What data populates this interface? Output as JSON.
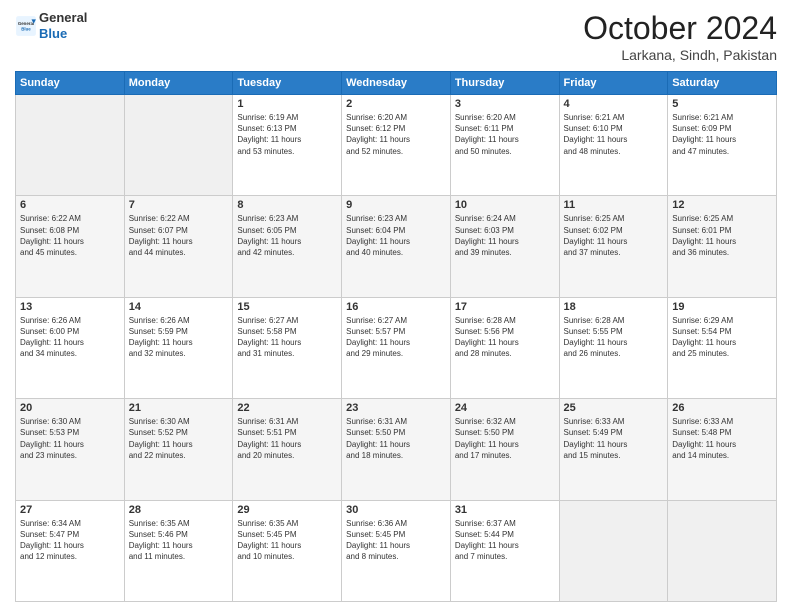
{
  "header": {
    "logo_general": "General",
    "logo_blue": "Blue",
    "title": "October 2024",
    "location": "Larkana, Sindh, Pakistan"
  },
  "days_of_week": [
    "Sunday",
    "Monday",
    "Tuesday",
    "Wednesday",
    "Thursday",
    "Friday",
    "Saturday"
  ],
  "weeks": [
    [
      {
        "day": "",
        "info": ""
      },
      {
        "day": "",
        "info": ""
      },
      {
        "day": "1",
        "sunrise": "6:19 AM",
        "sunset": "6:13 PM",
        "daylight": "11 hours and 53 minutes."
      },
      {
        "day": "2",
        "sunrise": "6:20 AM",
        "sunset": "6:12 PM",
        "daylight": "11 hours and 52 minutes."
      },
      {
        "day": "3",
        "sunrise": "6:20 AM",
        "sunset": "6:11 PM",
        "daylight": "11 hours and 50 minutes."
      },
      {
        "day": "4",
        "sunrise": "6:21 AM",
        "sunset": "6:10 PM",
        "daylight": "11 hours and 48 minutes."
      },
      {
        "day": "5",
        "sunrise": "6:21 AM",
        "sunset": "6:09 PM",
        "daylight": "11 hours and 47 minutes."
      }
    ],
    [
      {
        "day": "6",
        "sunrise": "6:22 AM",
        "sunset": "6:08 PM",
        "daylight": "11 hours and 45 minutes."
      },
      {
        "day": "7",
        "sunrise": "6:22 AM",
        "sunset": "6:07 PM",
        "daylight": "11 hours and 44 minutes."
      },
      {
        "day": "8",
        "sunrise": "6:23 AM",
        "sunset": "6:05 PM",
        "daylight": "11 hours and 42 minutes."
      },
      {
        "day": "9",
        "sunrise": "6:23 AM",
        "sunset": "6:04 PM",
        "daylight": "11 hours and 40 minutes."
      },
      {
        "day": "10",
        "sunrise": "6:24 AM",
        "sunset": "6:03 PM",
        "daylight": "11 hours and 39 minutes."
      },
      {
        "day": "11",
        "sunrise": "6:25 AM",
        "sunset": "6:02 PM",
        "daylight": "11 hours and 37 minutes."
      },
      {
        "day": "12",
        "sunrise": "6:25 AM",
        "sunset": "6:01 PM",
        "daylight": "11 hours and 36 minutes."
      }
    ],
    [
      {
        "day": "13",
        "sunrise": "6:26 AM",
        "sunset": "6:00 PM",
        "daylight": "11 hours and 34 minutes."
      },
      {
        "day": "14",
        "sunrise": "6:26 AM",
        "sunset": "5:59 PM",
        "daylight": "11 hours and 32 minutes."
      },
      {
        "day": "15",
        "sunrise": "6:27 AM",
        "sunset": "5:58 PM",
        "daylight": "11 hours and 31 minutes."
      },
      {
        "day": "16",
        "sunrise": "6:27 AM",
        "sunset": "5:57 PM",
        "daylight": "11 hours and 29 minutes."
      },
      {
        "day": "17",
        "sunrise": "6:28 AM",
        "sunset": "5:56 PM",
        "daylight": "11 hours and 28 minutes."
      },
      {
        "day": "18",
        "sunrise": "6:28 AM",
        "sunset": "5:55 PM",
        "daylight": "11 hours and 26 minutes."
      },
      {
        "day": "19",
        "sunrise": "6:29 AM",
        "sunset": "5:54 PM",
        "daylight": "11 hours and 25 minutes."
      }
    ],
    [
      {
        "day": "20",
        "sunrise": "6:30 AM",
        "sunset": "5:53 PM",
        "daylight": "11 hours and 23 minutes."
      },
      {
        "day": "21",
        "sunrise": "6:30 AM",
        "sunset": "5:52 PM",
        "daylight": "11 hours and 22 minutes."
      },
      {
        "day": "22",
        "sunrise": "6:31 AM",
        "sunset": "5:51 PM",
        "daylight": "11 hours and 20 minutes."
      },
      {
        "day": "23",
        "sunrise": "6:31 AM",
        "sunset": "5:50 PM",
        "daylight": "11 hours and 18 minutes."
      },
      {
        "day": "24",
        "sunrise": "6:32 AM",
        "sunset": "5:50 PM",
        "daylight": "11 hours and 17 minutes."
      },
      {
        "day": "25",
        "sunrise": "6:33 AM",
        "sunset": "5:49 PM",
        "daylight": "11 hours and 15 minutes."
      },
      {
        "day": "26",
        "sunrise": "6:33 AM",
        "sunset": "5:48 PM",
        "daylight": "11 hours and 14 minutes."
      }
    ],
    [
      {
        "day": "27",
        "sunrise": "6:34 AM",
        "sunset": "5:47 PM",
        "daylight": "11 hours and 12 minutes."
      },
      {
        "day": "28",
        "sunrise": "6:35 AM",
        "sunset": "5:46 PM",
        "daylight": "11 hours and 11 minutes."
      },
      {
        "day": "29",
        "sunrise": "6:35 AM",
        "sunset": "5:45 PM",
        "daylight": "11 hours and 10 minutes."
      },
      {
        "day": "30",
        "sunrise": "6:36 AM",
        "sunset": "5:45 PM",
        "daylight": "11 hours and 8 minutes."
      },
      {
        "day": "31",
        "sunrise": "6:37 AM",
        "sunset": "5:44 PM",
        "daylight": "11 hours and 7 minutes."
      },
      {
        "day": "",
        "info": ""
      },
      {
        "day": "",
        "info": ""
      }
    ]
  ]
}
